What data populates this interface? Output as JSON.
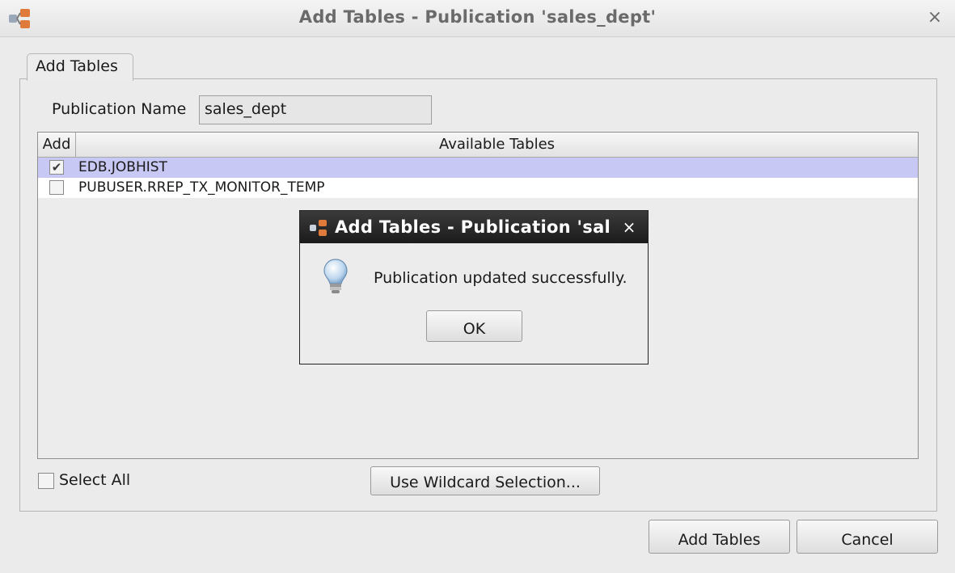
{
  "window": {
    "title": "Add Tables - Publication 'sales_dept'",
    "close_symbol": "×",
    "app_icon": "replication-server-icon"
  },
  "tab": {
    "label": "Add Tables"
  },
  "publication": {
    "label": "Publication Name",
    "value": "sales_dept"
  },
  "table": {
    "headers": {
      "add": "Add",
      "available": "Available Tables"
    },
    "rows": [
      {
        "checked": true,
        "name": "EDB.JOBHIST",
        "selected": true
      },
      {
        "checked": false,
        "name": "PUBUSER.RREP_TX_MONITOR_TEMP",
        "selected": false
      }
    ]
  },
  "select_all": {
    "label": "Select All",
    "checked": false
  },
  "buttons": {
    "wildcard": "Use Wildcard Selection...",
    "add_tables": "Add Tables",
    "cancel": "Cancel"
  },
  "dialog": {
    "title": "Add Tables - Publication 'sal",
    "close_symbol": "×",
    "icon": "lightbulb-icon",
    "message": "Publication updated successfully.",
    "ok": "OK"
  },
  "colors": {
    "selection": "#c8c8f4",
    "dialog_title_bg": "#2a2a2a"
  }
}
